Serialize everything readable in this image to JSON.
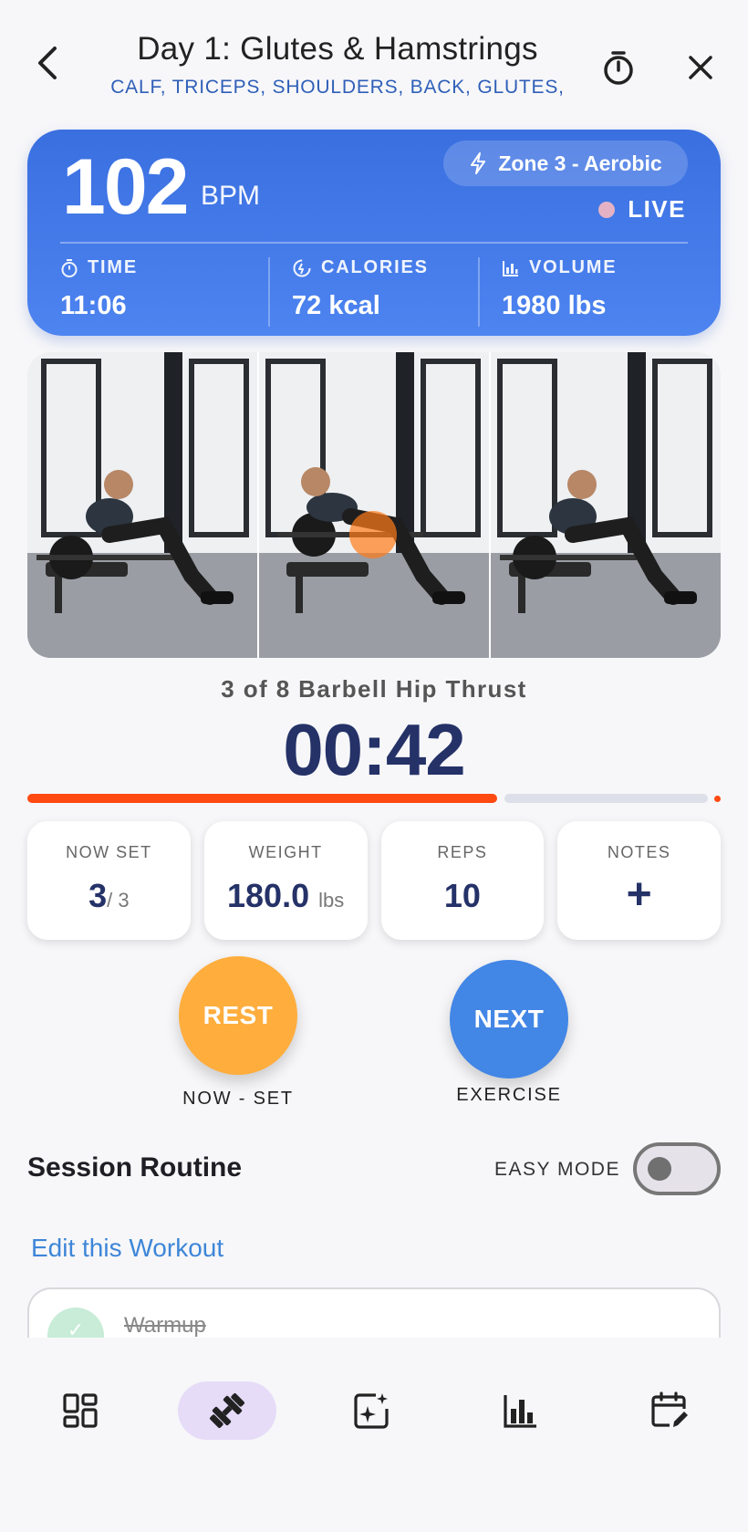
{
  "header": {
    "title": "Day 1: Glutes & Hamstrings",
    "subtitle": "CALF, TRICEPS, SHOULDERS, BACK, GLUTES,"
  },
  "heart": {
    "bpm": "102",
    "bpm_unit": "BPM",
    "zone": "Zone 3 - Aerobic",
    "live": "LIVE",
    "stats": [
      {
        "label": "TIME",
        "value": "11:06",
        "icon": "stopwatch-icon"
      },
      {
        "label": "CALORIES",
        "value": "72 kcal",
        "icon": "calories-icon"
      },
      {
        "label": "VOLUME",
        "value": "1980 lbs",
        "icon": "bar-chart-icon"
      }
    ],
    "colors": {
      "card_top": "#3a6fe0",
      "card_bottom": "#4d84f0",
      "live_dot": "#e4b2c4"
    }
  },
  "exercise": {
    "name": "3 of 8 Barbell Hip Thrust",
    "timer": "00:42",
    "progress": 0.69,
    "progress_color": "#ff4a12"
  },
  "cards": {
    "set": {
      "label": "NOW SET",
      "value": "3",
      "total": "/ 3"
    },
    "weight": {
      "label": "WEIGHT",
      "value": "180.0",
      "unit": "lbs"
    },
    "reps": {
      "label": "REPS",
      "value": "10"
    },
    "notes": {
      "label": "NOTES",
      "value": "+"
    }
  },
  "actions": {
    "rest": {
      "label": "REST",
      "caption": "NOW - SET",
      "color": "#ffad3d"
    },
    "next": {
      "label": "NEXT",
      "caption": "EXERCISE",
      "color": "#4286e6"
    }
  },
  "routine": {
    "title": "Session Routine",
    "easy_mode_label": "EASY MODE",
    "easy_mode_on": false,
    "edit_link": "Edit this Workout",
    "items": [
      {
        "name": "Warmup",
        "done": true
      }
    ]
  },
  "nav": {
    "items": [
      "dashboard-icon",
      "dumbbell-icon",
      "ai-sparkle-icon",
      "stats-icon",
      "calendar-edit-icon"
    ],
    "active_index": 1
  }
}
